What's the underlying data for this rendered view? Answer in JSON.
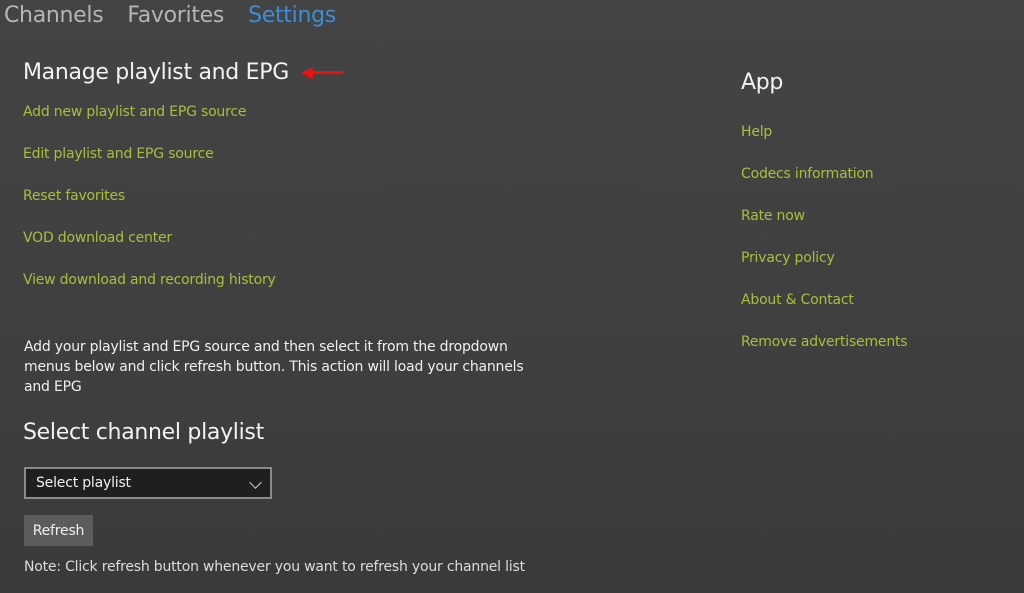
{
  "tabs": [
    {
      "label": "Channels",
      "active": false
    },
    {
      "label": "Favorites",
      "active": false
    },
    {
      "label": "Settings",
      "active": true
    }
  ],
  "colors": {
    "accent": "#3a8fd6",
    "link": "#a4c13c",
    "annotation_arrow": "#ee1111"
  },
  "manage": {
    "title": "Manage playlist and EPG",
    "links": [
      "Add new playlist and EPG source",
      "Edit playlist and EPG source",
      "Reset favorites",
      "VOD download center",
      "View download and recording history"
    ]
  },
  "description": "Add your playlist and EPG source and then select it from the dropdown menus below and click refresh button. This action will load your channels and EPG",
  "select_playlist": {
    "title": "Select channel playlist",
    "dropdown_value": "Select playlist",
    "refresh_label": "Refresh",
    "note": "Note: Click refresh button whenever you want to refresh your channel list"
  },
  "app": {
    "title": "App",
    "links": [
      "Help",
      "Codecs information",
      "Rate now",
      "Privacy policy",
      "About & Contact",
      "Remove advertisements"
    ]
  }
}
